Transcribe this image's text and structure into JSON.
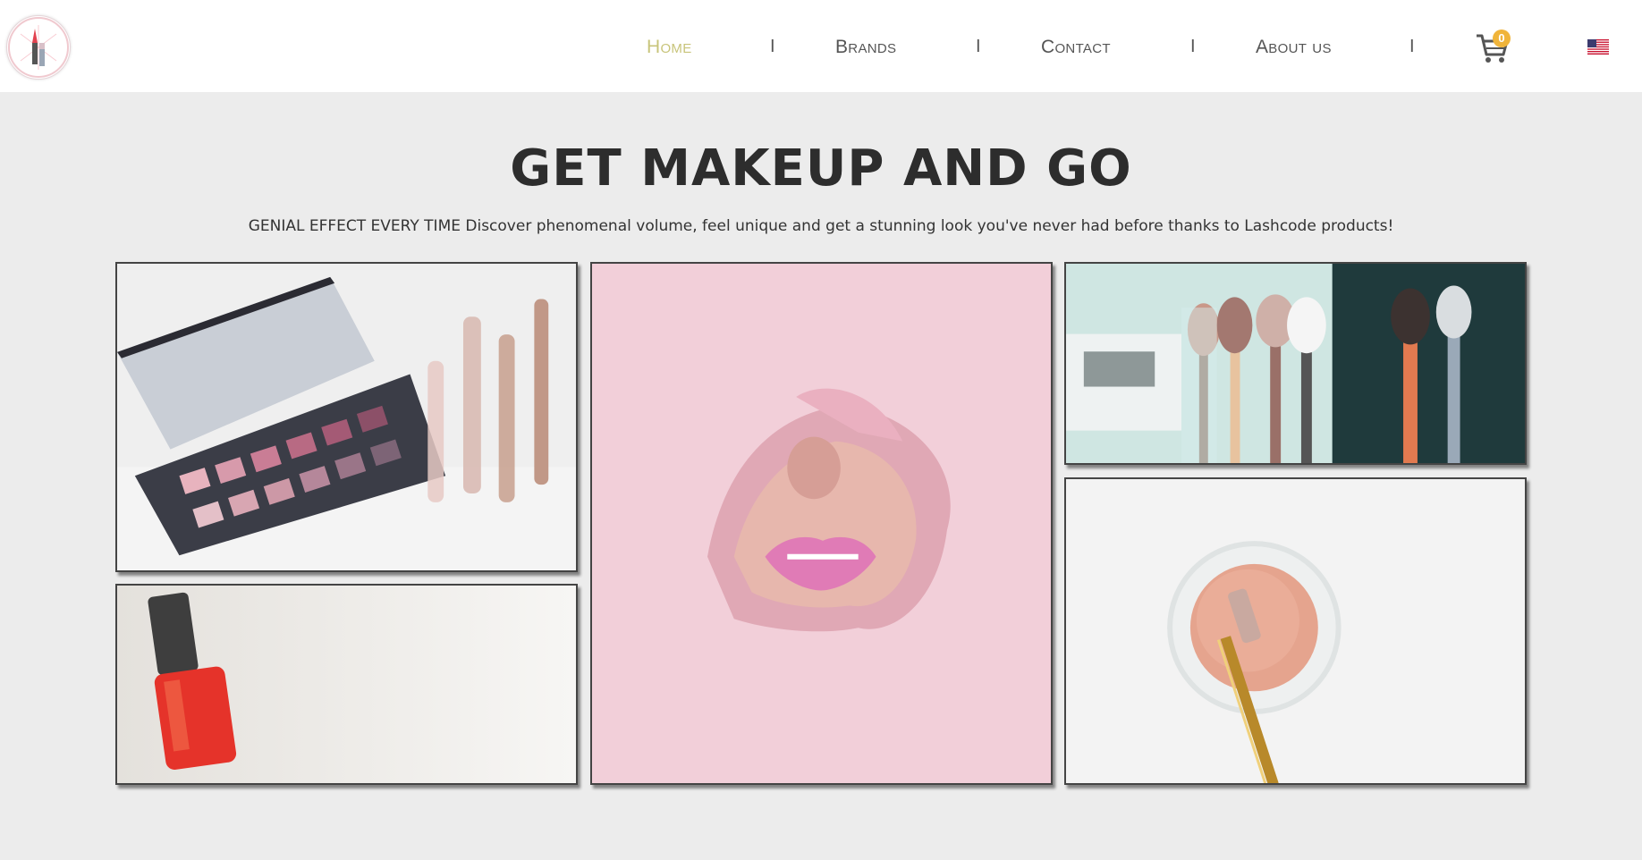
{
  "nav": {
    "items": [
      {
        "label": "Home",
        "active": true
      },
      {
        "label": "Brands",
        "active": false
      },
      {
        "label": "Contact",
        "active": false
      },
      {
        "label": "About us",
        "active": false
      }
    ],
    "separator": "I",
    "cart_count": "0",
    "language_flag": "us-flag-icon"
  },
  "hero": {
    "title": "GET MAKEUP AND GO",
    "subtitle": "GENIAL EFFECT EVERY TIME Discover phenomenal volume, feel unique and get a stunning look you've never had before thanks to Lashcode products!"
  },
  "gallery": {
    "images": [
      "eyeshadow-palette-image",
      "pink-lips-image",
      "makeup-brushes-image",
      "red-nail-polish-image",
      "blush-powder-image"
    ]
  },
  "colors": {
    "active_nav": "#c8c47a",
    "background": "#ececec",
    "cart_badge": "#f0b43a"
  }
}
